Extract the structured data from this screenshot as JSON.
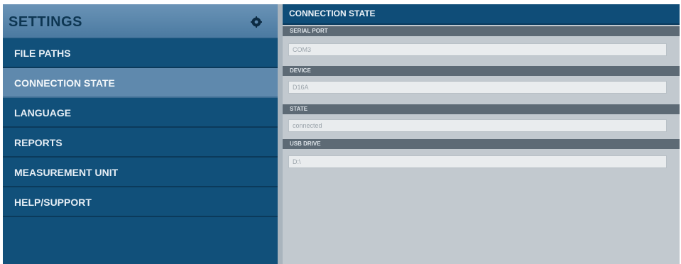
{
  "sidebar": {
    "title": "SETTINGS",
    "items": [
      {
        "label": "FILE PATHS"
      },
      {
        "label": "CONNECTION STATE"
      },
      {
        "label": "LANGUAGE"
      },
      {
        "label": "REPORTS"
      },
      {
        "label": "MEASUREMENT UNIT"
      },
      {
        "label": "HELP/SUPPORT"
      }
    ],
    "active_item": "CONNECTION STATE"
  },
  "content": {
    "title": "CONNECTION STATE",
    "fields": [
      {
        "label": "SERIAL PORT",
        "value": "COM3"
      },
      {
        "label": "DEVICE",
        "value": "D16A"
      },
      {
        "label": "STATE",
        "value": "connected"
      },
      {
        "label": "USB DRIVE",
        "value": "D:\\"
      }
    ]
  },
  "colors": {
    "sidebar_bg": "#11507a",
    "active_item_bg": "#5f89ad",
    "content_bg": "#c2c9cf",
    "label_bar": "#5d6a75"
  }
}
